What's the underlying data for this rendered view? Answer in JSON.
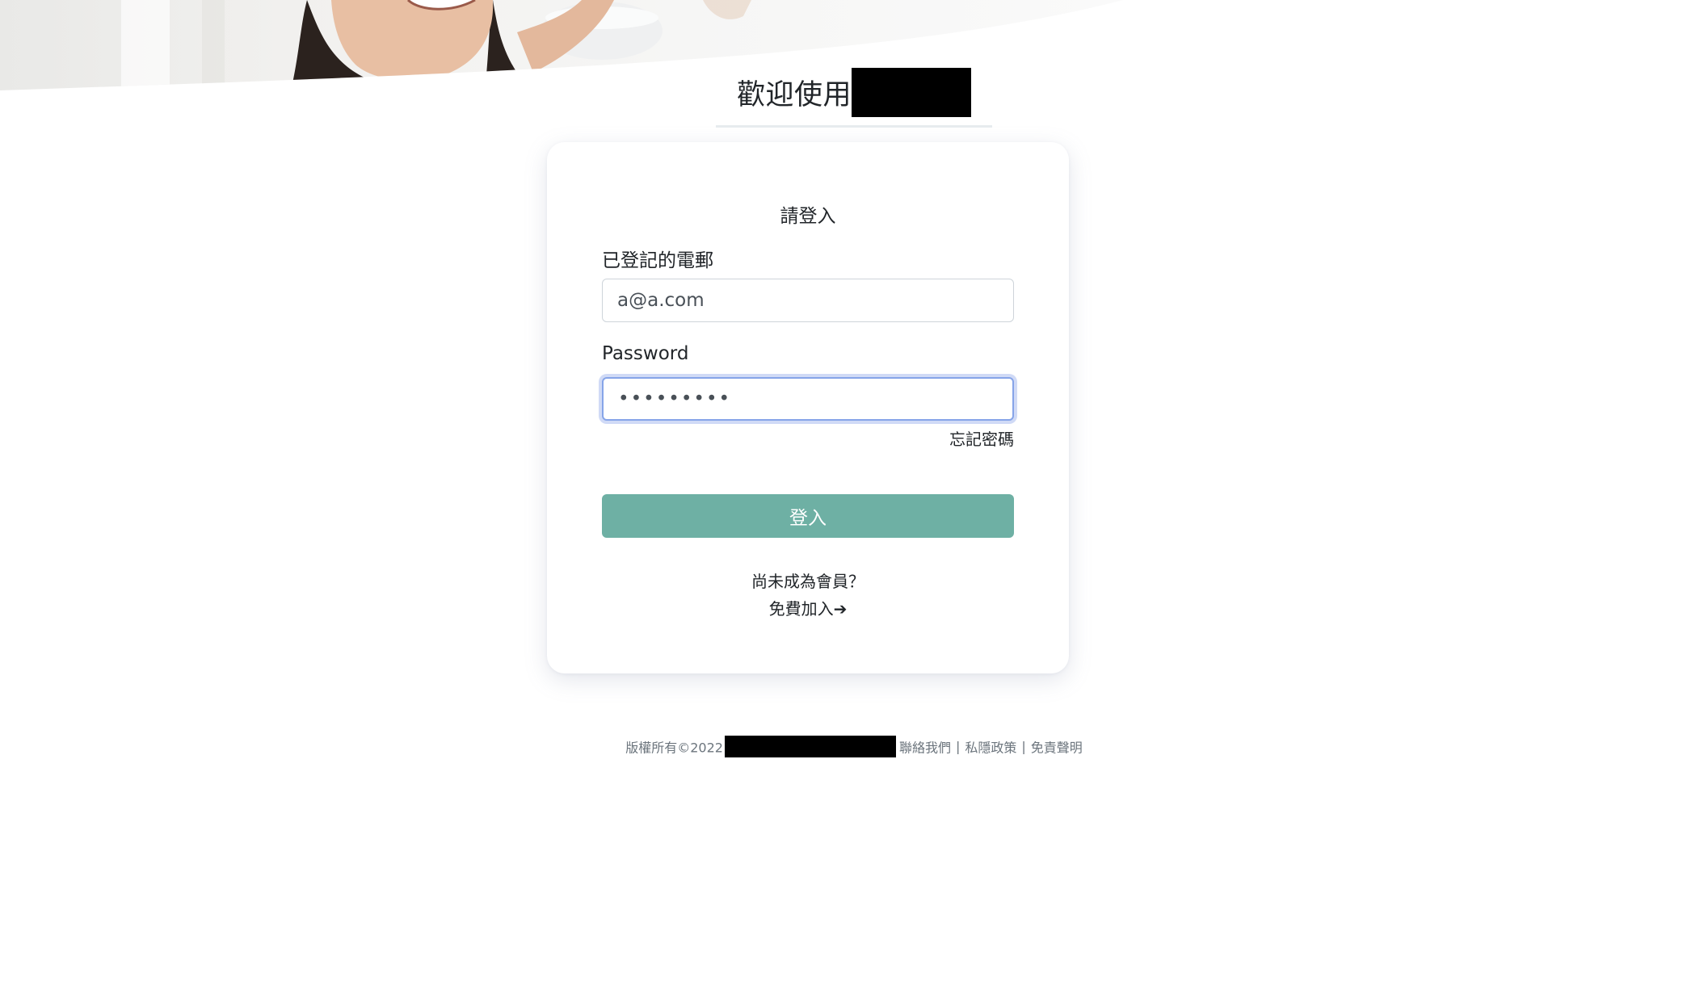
{
  "header": {
    "welcome_text": "歡迎使用"
  },
  "login_card": {
    "heading": "請登入",
    "email_label": "已登記的電郵",
    "email_value": "a@a.com",
    "password_label": "Password",
    "password_value": "•••••••••",
    "forgot_password": "忘記密碼",
    "login_button": "登入",
    "not_member_text": "尚未成為會員？",
    "join_link": "免費加入➔"
  },
  "footer": {
    "copyright": "版權所有©2022",
    "contact": "聯絡我們",
    "privacy": "私隱政策",
    "disclaimer": "免責聲明",
    "separator": "|"
  },
  "colors": {
    "primary_button": "#6eb0a4",
    "focus_ring": "#86a4e8",
    "footer_text": "#6c757d"
  }
}
